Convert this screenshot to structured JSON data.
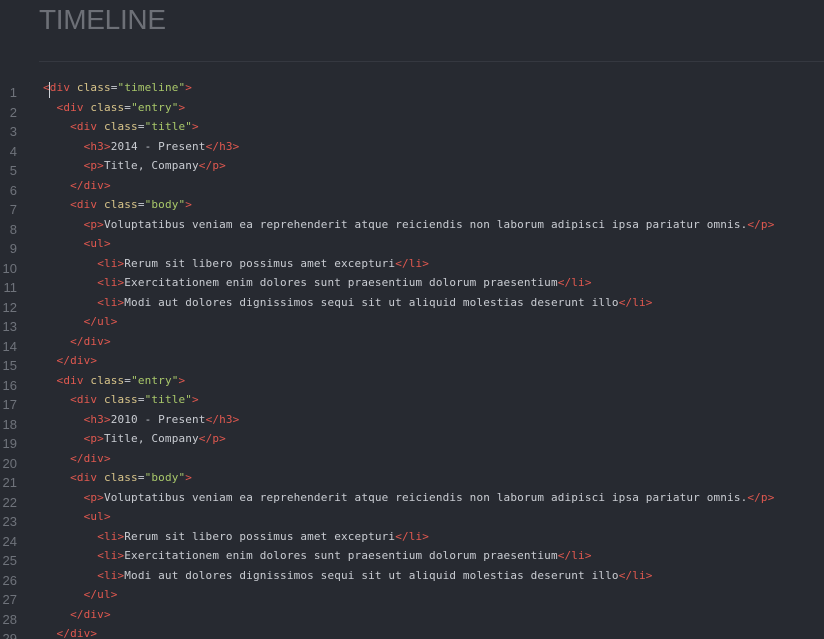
{
  "section": {
    "title": "TIMELINE"
  },
  "colors": {
    "background": "#272a31",
    "tag": "#e0584f",
    "attribute": "#d8c48a",
    "string": "#a9c86a",
    "text": "#c9ccd2",
    "gutter": "#6f737b"
  },
  "editor": {
    "lines": [
      {
        "n": "1",
        "indent": "",
        "tokens": [
          [
            "t",
            "<"
          ],
          [
            "t",
            "div"
          ],
          [
            "x",
            " "
          ],
          [
            "a",
            "class"
          ],
          [
            "x",
            "="
          ],
          [
            "s",
            "\"timeline\""
          ],
          [
            "t",
            ">"
          ]
        ]
      },
      {
        "n": "2",
        "indent": "  ",
        "tokens": [
          [
            "t",
            "<div"
          ],
          [
            "x",
            " "
          ],
          [
            "a",
            "class"
          ],
          [
            "x",
            "="
          ],
          [
            "s",
            "\"entry\""
          ],
          [
            "t",
            ">"
          ]
        ]
      },
      {
        "n": "3",
        "indent": "    ",
        "tokens": [
          [
            "t",
            "<div"
          ],
          [
            "x",
            " "
          ],
          [
            "a",
            "class"
          ],
          [
            "x",
            "="
          ],
          [
            "s",
            "\"title\""
          ],
          [
            "t",
            ">"
          ]
        ]
      },
      {
        "n": "4",
        "indent": "      ",
        "tokens": [
          [
            "t",
            "<h3>"
          ],
          [
            "x",
            "2014 - Present"
          ],
          [
            "t",
            "</h3>"
          ]
        ]
      },
      {
        "n": "5",
        "indent": "      ",
        "tokens": [
          [
            "t",
            "<p>"
          ],
          [
            "x",
            "Title, Company"
          ],
          [
            "t",
            "</p>"
          ]
        ]
      },
      {
        "n": "6",
        "indent": "    ",
        "tokens": [
          [
            "t",
            "</div>"
          ]
        ]
      },
      {
        "n": "7",
        "indent": "    ",
        "tokens": [
          [
            "t",
            "<div"
          ],
          [
            "x",
            " "
          ],
          [
            "a",
            "class"
          ],
          [
            "x",
            "="
          ],
          [
            "s",
            "\"body\""
          ],
          [
            "t",
            ">"
          ]
        ]
      },
      {
        "n": "8",
        "indent": "      ",
        "tokens": [
          [
            "t",
            "<p>"
          ],
          [
            "x",
            "Voluptatibus veniam ea reprehenderit atque reiciendis non laborum adipisci ipsa pariatur omnis."
          ],
          [
            "t",
            "</p>"
          ]
        ]
      },
      {
        "n": "9",
        "indent": "      ",
        "tokens": [
          [
            "t",
            "<ul>"
          ]
        ]
      },
      {
        "n": "10",
        "indent": "        ",
        "tokens": [
          [
            "t",
            "<li>"
          ],
          [
            "x",
            "Rerum sit libero possimus amet excepturi"
          ],
          [
            "t",
            "</li>"
          ]
        ]
      },
      {
        "n": "11",
        "indent": "        ",
        "tokens": [
          [
            "t",
            "<li>"
          ],
          [
            "x",
            "Exercitationem enim dolores sunt praesentium dolorum praesentium"
          ],
          [
            "t",
            "</li>"
          ]
        ]
      },
      {
        "n": "12",
        "indent": "        ",
        "tokens": [
          [
            "t",
            "<li>"
          ],
          [
            "x",
            "Modi aut dolores dignissimos sequi sit ut aliquid molestias deserunt illo"
          ],
          [
            "t",
            "</li>"
          ]
        ]
      },
      {
        "n": "13",
        "indent": "      ",
        "tokens": [
          [
            "t",
            "</ul>"
          ]
        ]
      },
      {
        "n": "14",
        "indent": "    ",
        "tokens": [
          [
            "t",
            "</div>"
          ]
        ]
      },
      {
        "n": "15",
        "indent": "  ",
        "tokens": [
          [
            "t",
            "</div>"
          ]
        ]
      },
      {
        "n": "16",
        "indent": "  ",
        "tokens": [
          [
            "t",
            "<div"
          ],
          [
            "x",
            " "
          ],
          [
            "a",
            "class"
          ],
          [
            "x",
            "="
          ],
          [
            "s",
            "\"entry\""
          ],
          [
            "t",
            ">"
          ]
        ]
      },
      {
        "n": "17",
        "indent": "    ",
        "tokens": [
          [
            "t",
            "<div"
          ],
          [
            "x",
            " "
          ],
          [
            "a",
            "class"
          ],
          [
            "x",
            "="
          ],
          [
            "s",
            "\"title\""
          ],
          [
            "t",
            ">"
          ]
        ]
      },
      {
        "n": "18",
        "indent": "      ",
        "tokens": [
          [
            "t",
            "<h3>"
          ],
          [
            "x",
            "2010 - Present"
          ],
          [
            "t",
            "</h3>"
          ]
        ]
      },
      {
        "n": "19",
        "indent": "      ",
        "tokens": [
          [
            "t",
            "<p>"
          ],
          [
            "x",
            "Title, Company"
          ],
          [
            "t",
            "</p>"
          ]
        ]
      },
      {
        "n": "20",
        "indent": "    ",
        "tokens": [
          [
            "t",
            "</div>"
          ]
        ]
      },
      {
        "n": "21",
        "indent": "    ",
        "tokens": [
          [
            "t",
            "<div"
          ],
          [
            "x",
            " "
          ],
          [
            "a",
            "class"
          ],
          [
            "x",
            "="
          ],
          [
            "s",
            "\"body\""
          ],
          [
            "t",
            ">"
          ]
        ]
      },
      {
        "n": "22",
        "indent": "      ",
        "tokens": [
          [
            "t",
            "<p>"
          ],
          [
            "x",
            "Voluptatibus veniam ea reprehenderit atque reiciendis non laborum adipisci ipsa pariatur omnis."
          ],
          [
            "t",
            "</p>"
          ]
        ]
      },
      {
        "n": "23",
        "indent": "      ",
        "tokens": [
          [
            "t",
            "<ul>"
          ]
        ]
      },
      {
        "n": "24",
        "indent": "        ",
        "tokens": [
          [
            "t",
            "<li>"
          ],
          [
            "x",
            "Rerum sit libero possimus amet excepturi"
          ],
          [
            "t",
            "</li>"
          ]
        ]
      },
      {
        "n": "25",
        "indent": "        ",
        "tokens": [
          [
            "t",
            "<li>"
          ],
          [
            "x",
            "Exercitationem enim dolores sunt praesentium dolorum praesentium"
          ],
          [
            "t",
            "</li>"
          ]
        ]
      },
      {
        "n": "26",
        "indent": "        ",
        "tokens": [
          [
            "t",
            "<li>"
          ],
          [
            "x",
            "Modi aut dolores dignissimos sequi sit ut aliquid molestias deserunt illo"
          ],
          [
            "t",
            "</li>"
          ]
        ]
      },
      {
        "n": "27",
        "indent": "      ",
        "tokens": [
          [
            "t",
            "</ul>"
          ]
        ]
      },
      {
        "n": "28",
        "indent": "    ",
        "tokens": [
          [
            "t",
            "</div>"
          ]
        ]
      },
      {
        "n": "29",
        "indent": "  ",
        "tokens": [
          [
            "t",
            "</div>"
          ]
        ]
      }
    ]
  }
}
